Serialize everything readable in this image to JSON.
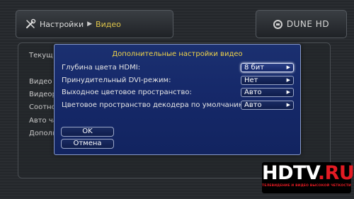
{
  "breadcrumb": {
    "root": "Настройки",
    "current": "Видео"
  },
  "brand": "DUNE HD",
  "background_items": [
    "Текущ",
    "Видео",
    "Видеор",
    "Соотно",
    "Авто ча",
    "Дополн"
  ],
  "dialog": {
    "title": "Дополнительные настройки видео",
    "rows": [
      {
        "label": "Глубина цвета HDMI:",
        "value": "8 бит",
        "selected": true
      },
      {
        "label": "Принудительный DVI-режим:",
        "value": "Нет",
        "selected": false
      },
      {
        "label": "Выходное цветовое пространство:",
        "value": "Авто",
        "selected": false
      },
      {
        "label": "Цветовое пространство декодера по умолчанию:",
        "value": "Авто",
        "selected": false
      }
    ],
    "ok_label": "OK",
    "cancel_label": "Отмена"
  },
  "watermark": {
    "main": "HDTV",
    "suffix": ".RU",
    "subtitle": "ТЕЛЕВИДЕНИЕ И ВИДЕО ВЫСОКОЙ ЧЕТКОСТИ"
  },
  "colors": {
    "dialog_bg": "#16296a",
    "title": "#f0d44a",
    "breadcrumb_current": "#e0c64a",
    "logo_red": "#e31b23"
  }
}
